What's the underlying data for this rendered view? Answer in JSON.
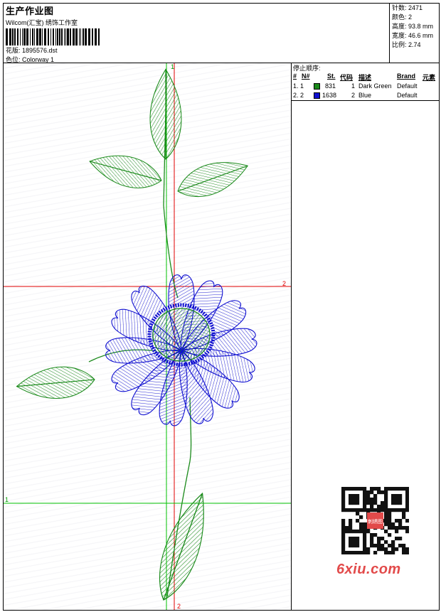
{
  "header": {
    "title": "生产作业图",
    "company": "Wilcom(汇宝) 绣饰工作室",
    "design": "花版: 1895576.dst",
    "colorway": "色位: Colorway 1"
  },
  "stats": [
    "针数: 2471",
    "颜色: 2",
    "高度: 93.8 mm",
    "宽度: 46.6 mm",
    "比例: 2.74"
  ],
  "stop_sequence": {
    "title": "停止顺序:",
    "headers": [
      "#",
      "N#",
      "St.",
      "代码",
      "描述",
      "Brand",
      "元素"
    ],
    "rows": [
      {
        "idx": "1. 1",
        "color": "#1a8a1a",
        "stitches": "831",
        "code": "1",
        "desc": "Dark Green",
        "brand": "Default"
      },
      {
        "idx": "2. 2",
        "color": "#1010d0",
        "stitches": "1638",
        "code": "2",
        "desc": "Blue",
        "brand": "Default"
      }
    ]
  },
  "markers": {
    "v1": "1",
    "h2": "2",
    "h1": "1",
    "v2": "2"
  },
  "watermark": {
    "logo": "6xiu.com",
    "stamp": "刺绣图"
  },
  "colors": {
    "green": "#1a8a1a",
    "blue": "#1010d0",
    "guide_red": "#e00000",
    "guide_green": "#00c000"
  }
}
